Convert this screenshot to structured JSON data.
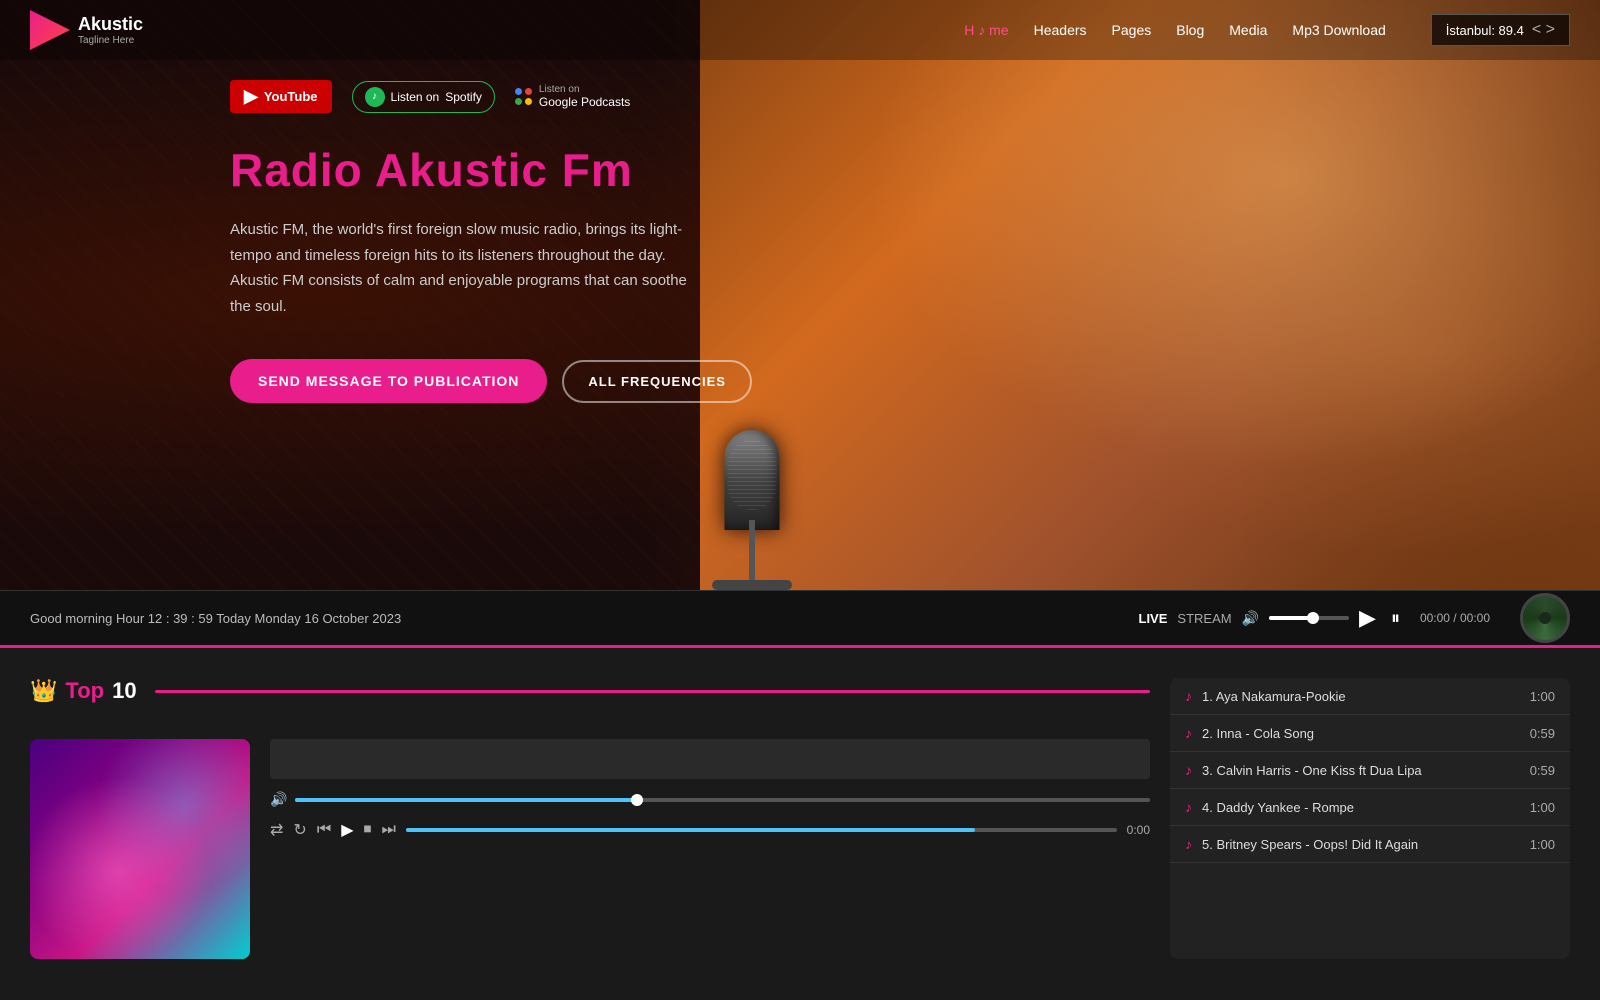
{
  "brand": {
    "name": "Akustic",
    "tagline": "Tagline Here"
  },
  "navbar": {
    "links": [
      {
        "label": "H ♪ me",
        "active": true
      },
      {
        "label": "Headers",
        "active": false
      },
      {
        "label": "Pages",
        "active": false
      },
      {
        "label": "Blog",
        "active": false
      },
      {
        "label": "Media",
        "active": false
      },
      {
        "label": "Mp3 Download",
        "active": false
      }
    ],
    "station": "İstanbul: 89.4"
  },
  "platforms": [
    {
      "name": "YouTube",
      "type": "youtube"
    },
    {
      "name": "Spotify",
      "type": "spotify"
    },
    {
      "name": "Google Podcasts",
      "type": "google"
    }
  ],
  "hero": {
    "title": "Radio Akustic Fm",
    "description": "Akustic FM, the world's first foreign slow music radio, brings its light-tempo and timeless foreign hits to its listeners throughout the day. Akustic FM consists of calm and enjoyable programs that can soothe the soul.",
    "btn_message": "SEND MESSAGE TO PUBLICATION",
    "btn_frequencies": "ALL FREQUENCIES"
  },
  "player_bar": {
    "greeting": "Good morning Hour 12 : 39 : 59 Today Monday 16 October 2023",
    "live_label": "LIVE",
    "stream_label": "STREAM",
    "time_display": "00:00 / 00:00"
  },
  "top10": {
    "label": "Top",
    "number": "10",
    "tracks": [
      {
        "rank": "1.",
        "name": "Aya Nakamura-Pookie",
        "duration": "1:00"
      },
      {
        "rank": "2.",
        "name": "Inna - Cola Song",
        "duration": "0:59"
      },
      {
        "rank": "3.",
        "name": "Calvin Harris - One Kiss ft Dua Lipa",
        "duration": "0:59"
      },
      {
        "rank": "4.",
        "name": "Daddy Yankee - Rompe",
        "duration": "1:00"
      },
      {
        "rank": "5.",
        "name": "Britney Spears - Oops! Did It Again",
        "duration": "1:00"
      }
    ],
    "current_time": "0:00"
  }
}
